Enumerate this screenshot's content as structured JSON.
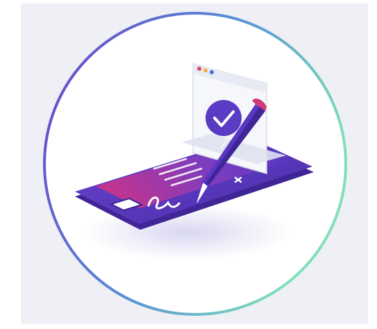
{
  "illustration": {
    "subject": "e-signature-on-smartphone-icon",
    "colors": {
      "background": "#eef0f5",
      "ring_start": "#6a3fc8",
      "ring_end": "#7fe0b8",
      "phone_body": "#5b36c2",
      "phone_dark": "#3f2596",
      "screen_start": "#c2358f",
      "screen_end": "#6a3fc8",
      "check_badge": "#5a3cc4",
      "pen_body": "#5b36c2",
      "pen_accent": "#d13a7a"
    },
    "browser_dots": [
      "#e2455f",
      "#f2b13c",
      "#4b6be0"
    ]
  }
}
